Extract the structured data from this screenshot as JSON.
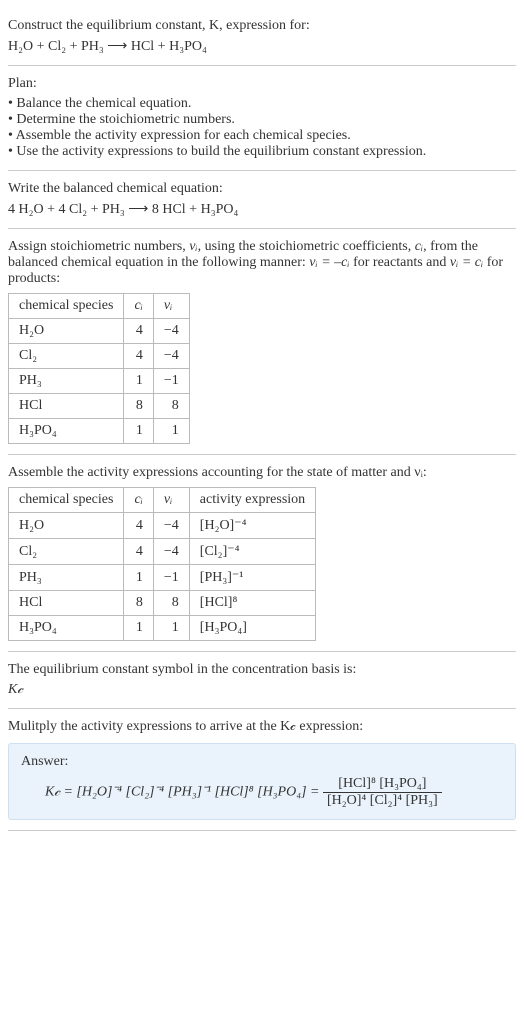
{
  "intro": {
    "lead": "Construct the equilibrium constant, K, expression for:",
    "equation": "H₂O + Cl₂ + PH₃ ⟶ HCl + H₃PO₄"
  },
  "plan": {
    "title": "Plan:",
    "items": [
      "Balance the chemical equation.",
      "Determine the stoichiometric numbers.",
      "Assemble the activity expression for each chemical species.",
      "Use the activity expressions to build the equilibrium constant expression."
    ]
  },
  "balanced": {
    "lead": "Write the balanced chemical equation:",
    "equation": "4 H₂O + 4 Cl₂ + PH₃ ⟶ 8 HCl + H₃PO₄"
  },
  "stoich": {
    "lead_a": "Assign stoichiometric numbers, ",
    "nu": "νᵢ",
    "lead_b": ", using the stoichiometric coefficients, ",
    "ci": "cᵢ",
    "lead_c": ", from the balanced chemical equation in the following manner: ",
    "rel_react": "νᵢ = –cᵢ",
    "lead_d": " for reactants and ",
    "rel_prod": "νᵢ = cᵢ",
    "lead_e": " for products:",
    "headers": [
      "chemical species",
      "cᵢ",
      "νᵢ"
    ],
    "rows": [
      {
        "sp": "H₂O",
        "c": "4",
        "n": "−4"
      },
      {
        "sp": "Cl₂",
        "c": "4",
        "n": "−4"
      },
      {
        "sp": "PH₃",
        "c": "1",
        "n": "−1"
      },
      {
        "sp": "HCl",
        "c": "8",
        "n": "8"
      },
      {
        "sp": "H₃PO₄",
        "c": "1",
        "n": "1"
      }
    ]
  },
  "activity": {
    "lead": "Assemble the activity expressions accounting for the state of matter and νᵢ:",
    "headers": [
      "chemical species",
      "cᵢ",
      "νᵢ",
      "activity expression"
    ],
    "rows": [
      {
        "sp": "H₂O",
        "c": "4",
        "n": "−4",
        "ae": "[H₂O]⁻⁴"
      },
      {
        "sp": "Cl₂",
        "c": "4",
        "n": "−4",
        "ae": "[Cl₂]⁻⁴"
      },
      {
        "sp": "PH₃",
        "c": "1",
        "n": "−1",
        "ae": "[PH₃]⁻¹"
      },
      {
        "sp": "HCl",
        "c": "8",
        "n": "8",
        "ae": "[HCl]⁸"
      },
      {
        "sp": "H₃PO₄",
        "c": "1",
        "n": "1",
        "ae": "[H₃PO₄]"
      }
    ]
  },
  "symbol": {
    "lead": "The equilibrium constant symbol in the concentration basis is:",
    "value": "K𝒸"
  },
  "multiply": {
    "lead": "Mulitply the activity expressions to arrive at the K𝒸 expression:"
  },
  "answer": {
    "label": "Answer:",
    "lhs": "K𝒸 = [H₂O]⁻⁴ [Cl₂]⁻⁴ [PH₃]⁻¹ [HCl]⁸ [H₃PO₄] = ",
    "frac_num": "[HCl]⁸ [H₃PO₄]",
    "frac_den": "[H₂O]⁴ [Cl₂]⁴ [PH₃]"
  }
}
